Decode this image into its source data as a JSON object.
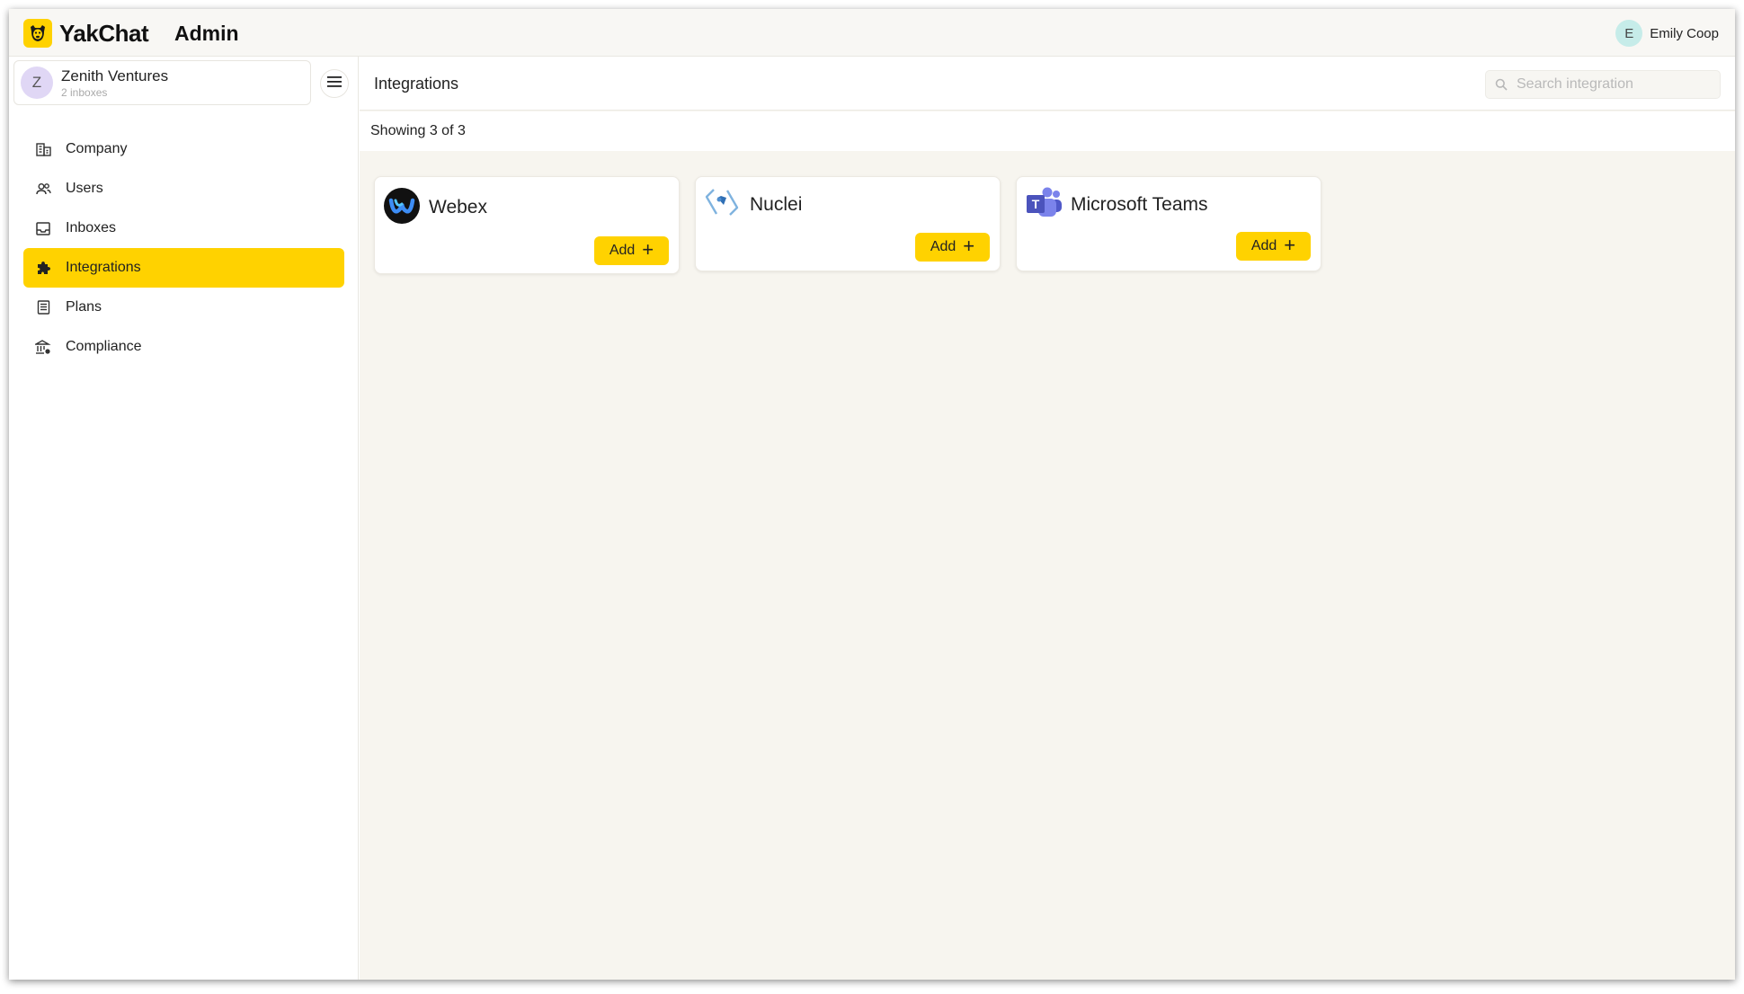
{
  "app": {
    "brand": "YakChat",
    "section": "Admin",
    "user": {
      "initial": "E",
      "name": "Emily Coop"
    },
    "colors": {
      "accent": "#ffd200",
      "background": "#f7f5ef"
    }
  },
  "sidebar": {
    "org": {
      "initial": "Z",
      "name": "Zenith Ventures",
      "sub": "2 inboxes"
    },
    "items": [
      {
        "label": "Company",
        "icon": "building-icon",
        "active": false
      },
      {
        "label": "Users",
        "icon": "users-icon",
        "active": false
      },
      {
        "label": "Inboxes",
        "icon": "inbox-icon",
        "active": false
      },
      {
        "label": "Integrations",
        "icon": "puzzle-icon",
        "active": true
      },
      {
        "label": "Plans",
        "icon": "document-icon",
        "active": false
      },
      {
        "label": "Compliance",
        "icon": "bank-icon",
        "active": false
      }
    ]
  },
  "main": {
    "title": "Integrations",
    "search_placeholder": "Search integration",
    "count_text": "Showing 3 of 3",
    "integrations": [
      {
        "name": "Webex",
        "icon": "webex-logo-icon",
        "add_label": "Add"
      },
      {
        "name": "Nuclei",
        "icon": "nuclei-logo-icon",
        "add_label": "Add"
      },
      {
        "name": "Microsoft Teams",
        "icon": "microsoft-teams-logo-icon",
        "add_label": "Add"
      }
    ]
  }
}
